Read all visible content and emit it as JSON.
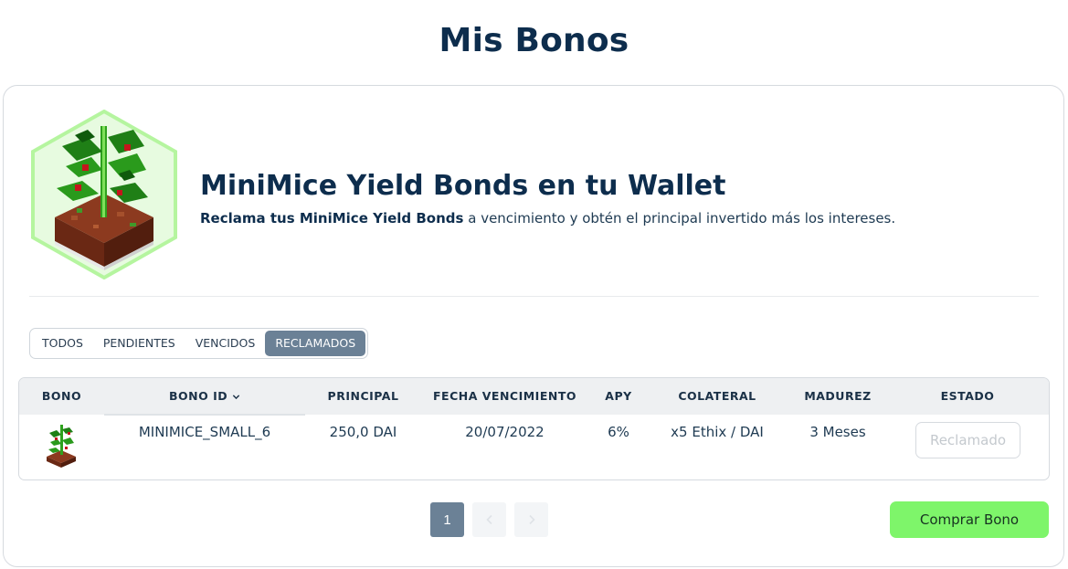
{
  "page": {
    "title": "Mis Bonos"
  },
  "hero": {
    "title": "MiniMice Yield Bonds en tu Wallet",
    "subtitle_bold": "Reclama tus MiniMice Yield Bonds",
    "subtitle_rest": " a vencimiento y obtén el principal invertido más los intereses.",
    "image_icon": "plant-voxel-icon"
  },
  "filters": {
    "tabs": [
      {
        "label": "TODOS"
      },
      {
        "label": "PENDIENTES"
      },
      {
        "label": "VENCIDOS"
      },
      {
        "label": "RECLAMADOS",
        "active": true
      }
    ]
  },
  "table": {
    "headers": {
      "bono": "BONO",
      "bono_id": "BONO ID",
      "principal": "PRINCIPAL",
      "fecha_vencimiento": "FECHA VENCIMIENTO",
      "apy": "APY",
      "colateral": "COLATERAL",
      "madurez": "MADUREZ",
      "estado": "ESTADO"
    },
    "sort_icon": "chevron-down-icon",
    "rows": [
      {
        "image_icon": "plant-voxel-icon",
        "bono_id": "MINIMICE_SMALL_6",
        "principal": "250,0 DAI",
        "fecha_vencimiento": "20/07/2022",
        "apy": "6%",
        "colateral": "x5 Ethix / DAI",
        "madurez": "3 Meses",
        "estado": "Reclamado"
      }
    ]
  },
  "pagination": {
    "current": "1",
    "prev_icon": "chevron-left-icon",
    "next_icon": "chevron-right-icon"
  },
  "actions": {
    "buy_label": "Comprar Bono"
  },
  "colors": {
    "accent_green": "#7ef56a",
    "active_slate": "#6b8196",
    "title_navy": "#0d2d4d"
  }
}
